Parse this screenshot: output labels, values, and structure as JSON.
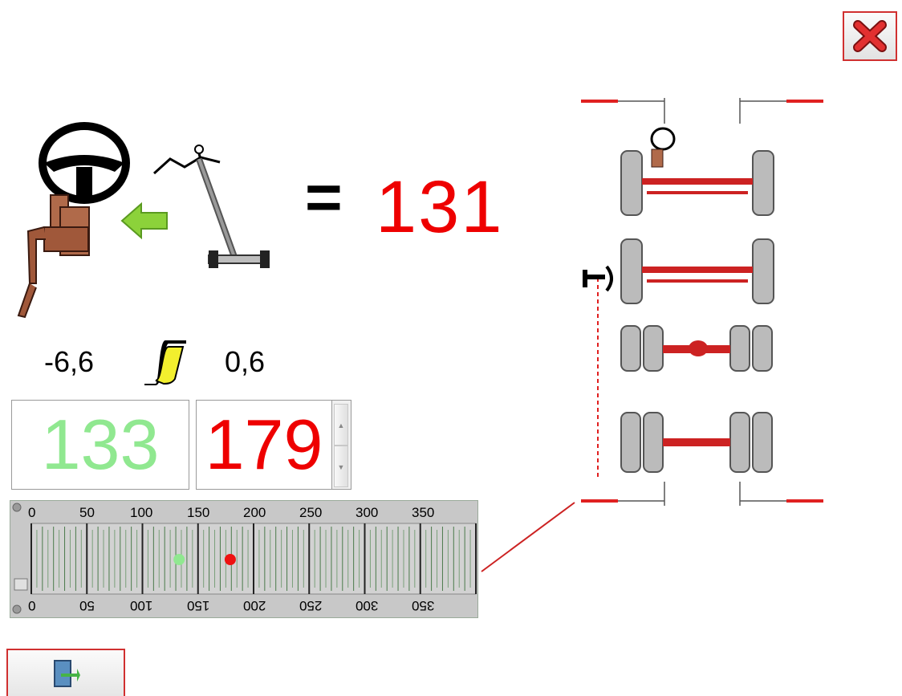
{
  "result": {
    "equals_sign": "=",
    "value": "131"
  },
  "offsets": {
    "left": "-6,6",
    "right": "0,6"
  },
  "readouts": {
    "green": "133",
    "red": "179"
  },
  "scale": {
    "top_labels": [
      "0",
      "50",
      "100",
      "150",
      "200",
      "250",
      "300",
      "350"
    ],
    "bottom_labels": [
      "0",
      "50",
      "100",
      "150",
      "200",
      "250",
      "300",
      "350"
    ],
    "markers": [
      {
        "name": "green-marker",
        "value": 133,
        "color": "#90e890"
      },
      {
        "name": "red-marker",
        "value": 179,
        "color": "#ee1111"
      }
    ]
  },
  "colors": {
    "accent_red": "#ee0000",
    "green": "#90e890",
    "axle": "#cc2222"
  },
  "icons": {
    "close": "close-icon",
    "exit": "exit-door-icon",
    "steering": "steering-wheel-icon",
    "tool": "alignment-tool-icon",
    "arrow": "green-arrow-left-icon",
    "curve": "yellow-curve-icon",
    "vehicle": "axle-diagram-icon"
  }
}
